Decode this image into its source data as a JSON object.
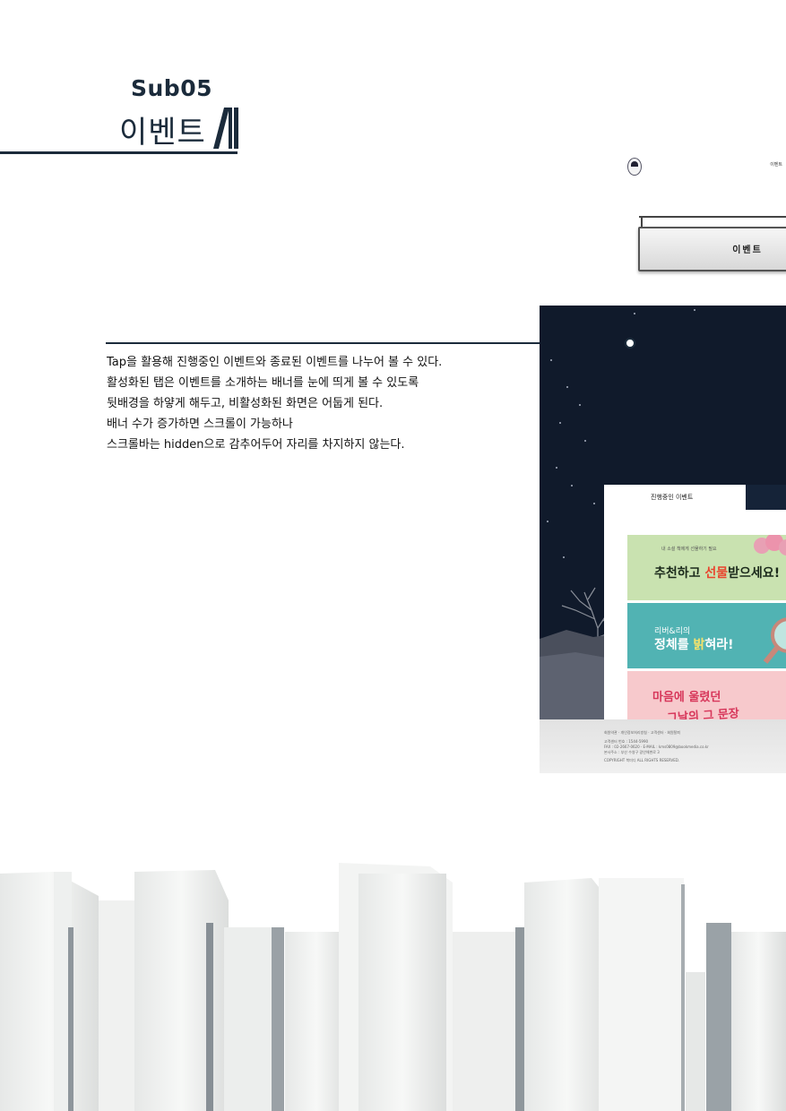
{
  "heading": {
    "sub_label": "Sub05",
    "title": "이벤트"
  },
  "description": {
    "lines": [
      "Tap을 활용해 진행중인 이벤트와 종료된 이벤트를 나누어 볼 수 있다.",
      "활성화된 탭은 이벤트를 소개하는 배너를 눈에 띄게 볼 수 있도록",
      "뒷배경을 하얗게 해두고, 비활성화된 화면은 어둡게 된다.",
      "배너 수가 증가하면 스크롤이 가능하나",
      "스크롤바는 hidden으로 감추어두어 자리를 차지하지 않는다."
    ]
  },
  "mockup": {
    "menu_label": "이벤트",
    "sign_label": "이벤트",
    "tabs": {
      "active": "진행중인 이벤트",
      "inactive": ""
    },
    "banners": [
      {
        "small": "내 소설 책에게 선물하기 필요",
        "big_prefix": "추천하고 ",
        "big_highlight": "선물",
        "big_suffix": "받으세요!"
      },
      {
        "small": "리버&리의",
        "big_prefix": "정체를 ",
        "big_highlight": "밝",
        "big_suffix": "혀라!"
      },
      {
        "line1": "마음에 울렸던",
        "line2": "그날의 그 문장"
      }
    ],
    "footer": {
      "links": "회원약관 · 개인정보처리방침 · 고객센터 · 회원탈퇴",
      "line1": "고객센터 번호 : 1544-5990",
      "line2": "FAX : 02-2667-0620  ·  E-MAIL : kms0809@bookmedia.co.kr",
      "line3": "본사주소 : 부산 수영구 광안해변로 3",
      "copyright": "COPYRIGHT 북미디 ALL RIGHTS RESERVED."
    }
  },
  "colors": {
    "navy": "#1b2b3b",
    "night_sky": "#101a2b",
    "banner_green": "#c9e2b0",
    "banner_teal": "#51b3b3",
    "banner_pink": "#f7c9cc"
  }
}
